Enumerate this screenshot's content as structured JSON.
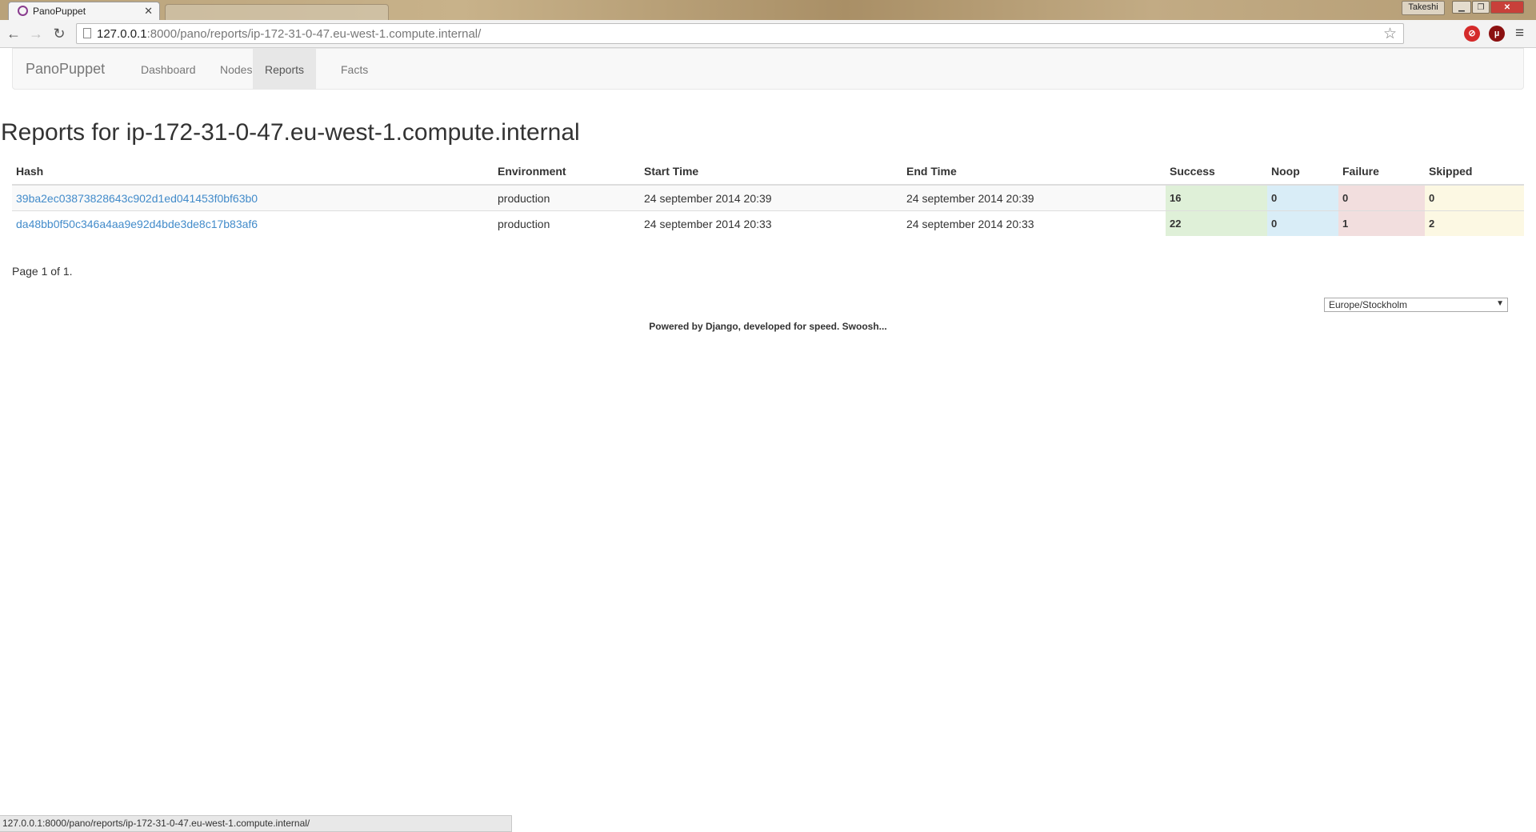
{
  "browser": {
    "tab_title": "PanoPuppet",
    "url_host": "127.0.0.1",
    "url_rest": ":8000/pano/reports/ip-172-31-0-47.eu-west-1.compute.internal/",
    "user": "Takeshi",
    "status_url": "127.0.0.1:8000/pano/reports/ip-172-31-0-47.eu-west-1.compute.internal/"
  },
  "navbar": {
    "brand": "PanoPuppet",
    "items": [
      {
        "label": "Dashboard",
        "active": false
      },
      {
        "label": "Nodes",
        "active": false
      },
      {
        "label": "Reports",
        "active": true
      },
      {
        "label": "Facts",
        "active": false
      }
    ]
  },
  "page": {
    "title": "Reports for ip-172-31-0-47.eu-west-1.compute.internal"
  },
  "table": {
    "headers": [
      "Hash",
      "Environment",
      "Start Time",
      "End Time",
      "Success",
      "Noop",
      "Failure",
      "Skipped"
    ],
    "rows": [
      {
        "hash": "39ba2ec03873828643c902d1ed041453f0bf63b0",
        "environment": "production",
        "start": "24 september 2014 20:39",
        "end": "24 september 2014 20:39",
        "success": "16",
        "noop": "0",
        "failure": "0",
        "skipped": "0"
      },
      {
        "hash": "da48bb0f50c346a4aa9e92d4bde3de8c17b83af6",
        "environment": "production",
        "start": "24 september 2014 20:33",
        "end": "24 september 2014 20:33",
        "success": "22",
        "noop": "0",
        "failure": "1",
        "skipped": "2"
      }
    ]
  },
  "pagination": {
    "text": "Page 1 of 1."
  },
  "timezone": {
    "selected": "Europe/Stockholm"
  },
  "footer": {
    "text": "Powered by Django, developed for speed. Swoosh..."
  },
  "colors": {
    "success": "#dff0d8",
    "info": "#d9edf7",
    "danger": "#f2dede",
    "warning": "#fcf8e3",
    "link": "#428bca"
  }
}
